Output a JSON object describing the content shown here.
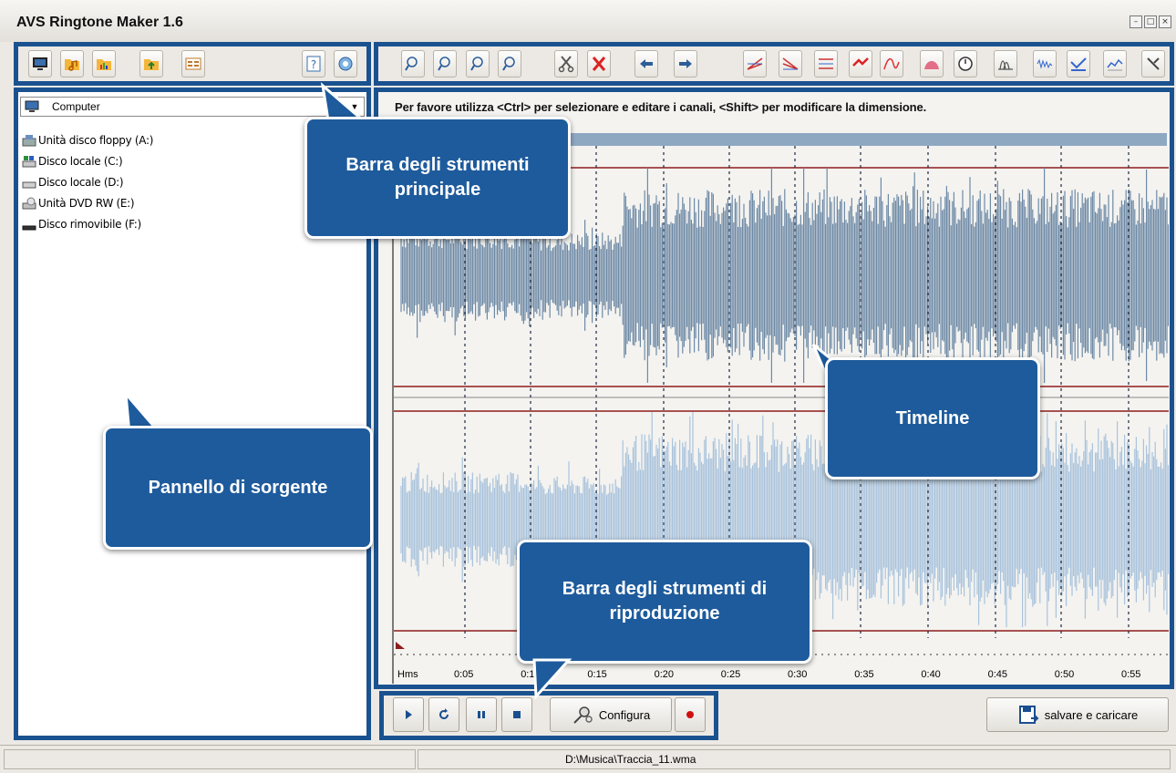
{
  "window": {
    "title": "AVS Ringtone Maker 1.6",
    "buttons": [
      "minimize",
      "maximize",
      "close"
    ]
  },
  "colors": {
    "frame_blue": "#1a5290",
    "callout_blue": "#1e5b9c",
    "wave_top": "#6e8aa6",
    "wave_bottom": "#a9c3dc",
    "marker_red": "#8e1c1c"
  },
  "toolbar": {
    "left_icons": [
      "computer-icon",
      "music-folder-icon",
      "chart-folder-icon",
      "upload-folder-icon",
      "list-view-icon"
    ],
    "help_icons": [
      "help-icon",
      "support-icon"
    ],
    "zoom_icons": [
      "zoom-in-icon",
      "zoom-out-icon",
      "zoom-selection-icon",
      "zoom-all-icon"
    ],
    "edit_icons": [
      "cut-icon",
      "delete-icon",
      "undo-icon",
      "redo-icon"
    ],
    "effect_icons": [
      "fade-in-icon",
      "fade-out-icon",
      "normalize-icon",
      "amplify-icon",
      "equalizer-icon",
      "reverb-icon",
      "timer-icon",
      "chorus-icon",
      "noise-icon",
      "compressor-icon",
      "spectrum-icon",
      "tools-icon"
    ]
  },
  "source_panel": {
    "location": "Computer",
    "drives": [
      {
        "label": "Unità disco floppy (A:)",
        "icon": "floppy-drive-icon"
      },
      {
        "label": "Disco locale (C:)",
        "icon": "system-disk-icon"
      },
      {
        "label": "Disco locale (D:)",
        "icon": "hard-disk-icon"
      },
      {
        "label": "Unità DVD RW (E:)",
        "icon": "dvd-drive-icon"
      },
      {
        "label": "Disco rimovibile (F:)",
        "icon": "removable-disk-icon"
      }
    ]
  },
  "timeline": {
    "hint": "Per favore utilizza <Ctrl> per selezionare e editare i canali, <Shift> per modificare la dimensione.",
    "ruler_unit": "Hms",
    "ticks": [
      "0:05",
      "0:1",
      "0:15",
      "0:20",
      "0:25",
      "0:30",
      "0:35",
      "0:40",
      "0:45",
      "0:50",
      "0:55"
    ]
  },
  "playback": {
    "buttons": [
      "play-icon",
      "loop-icon",
      "pause-icon",
      "stop-icon"
    ],
    "configure_label": "Configura",
    "record": "record-icon"
  },
  "save_label": "salvare e caricare",
  "status": {
    "file_path": "D:\\Musica\\Traccia_11.wma"
  },
  "callouts": {
    "main_toolbar": "Barra degli strumenti principale",
    "source_panel": "Pannello di sorgente",
    "timeline": "Timeline",
    "playback_toolbar": "Barra degli strumenti di riproduzione"
  }
}
